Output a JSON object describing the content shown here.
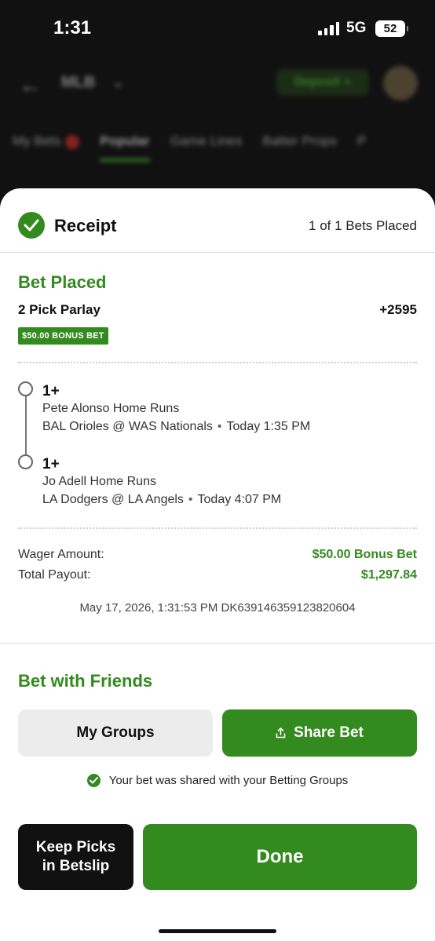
{
  "status_bar": {
    "time": "1:31",
    "network": "5G",
    "battery": "52"
  },
  "background_app": {
    "league": "MLB",
    "deposit_label": "Deposit +",
    "tabs": [
      "My Bets",
      "Popular",
      "Game Lines",
      "Batter Props",
      "P"
    ]
  },
  "receipt": {
    "title": "Receipt",
    "bets_placed": "1 of 1 Bets Placed",
    "status": "Bet Placed",
    "bet_type": "2 Pick Parlay",
    "odds": "+2595",
    "bonus_tag": "$50.00 BONUS BET",
    "legs": [
      {
        "value": "1+",
        "market": "Pete Alonso Home Runs",
        "game": "BAL Orioles @ WAS Nationals",
        "time": "Today 1:35 PM"
      },
      {
        "value": "1+",
        "market": "Jo Adell Home Runs",
        "game": "LA Dodgers @ LA Angels",
        "time": "Today 4:07 PM"
      }
    ],
    "wager_label": "Wager Amount:",
    "wager_value": "$50.00 Bonus Bet",
    "payout_label": "Total Payout:",
    "payout_value": "$1,297.84",
    "timestamp": "May 17, 2026, 1:31:53 PM DK639146359123820604"
  },
  "friends": {
    "title": "Bet with Friends",
    "my_groups_label": "My Groups",
    "share_label": "Share Bet",
    "shared_note": "Your bet was shared with your Betting Groups"
  },
  "actions": {
    "keep_picks_label": "Keep Picks\nin Betslip",
    "done_label": "Done"
  },
  "colors": {
    "accent_green": "#338a1e",
    "dark": "#111111"
  }
}
